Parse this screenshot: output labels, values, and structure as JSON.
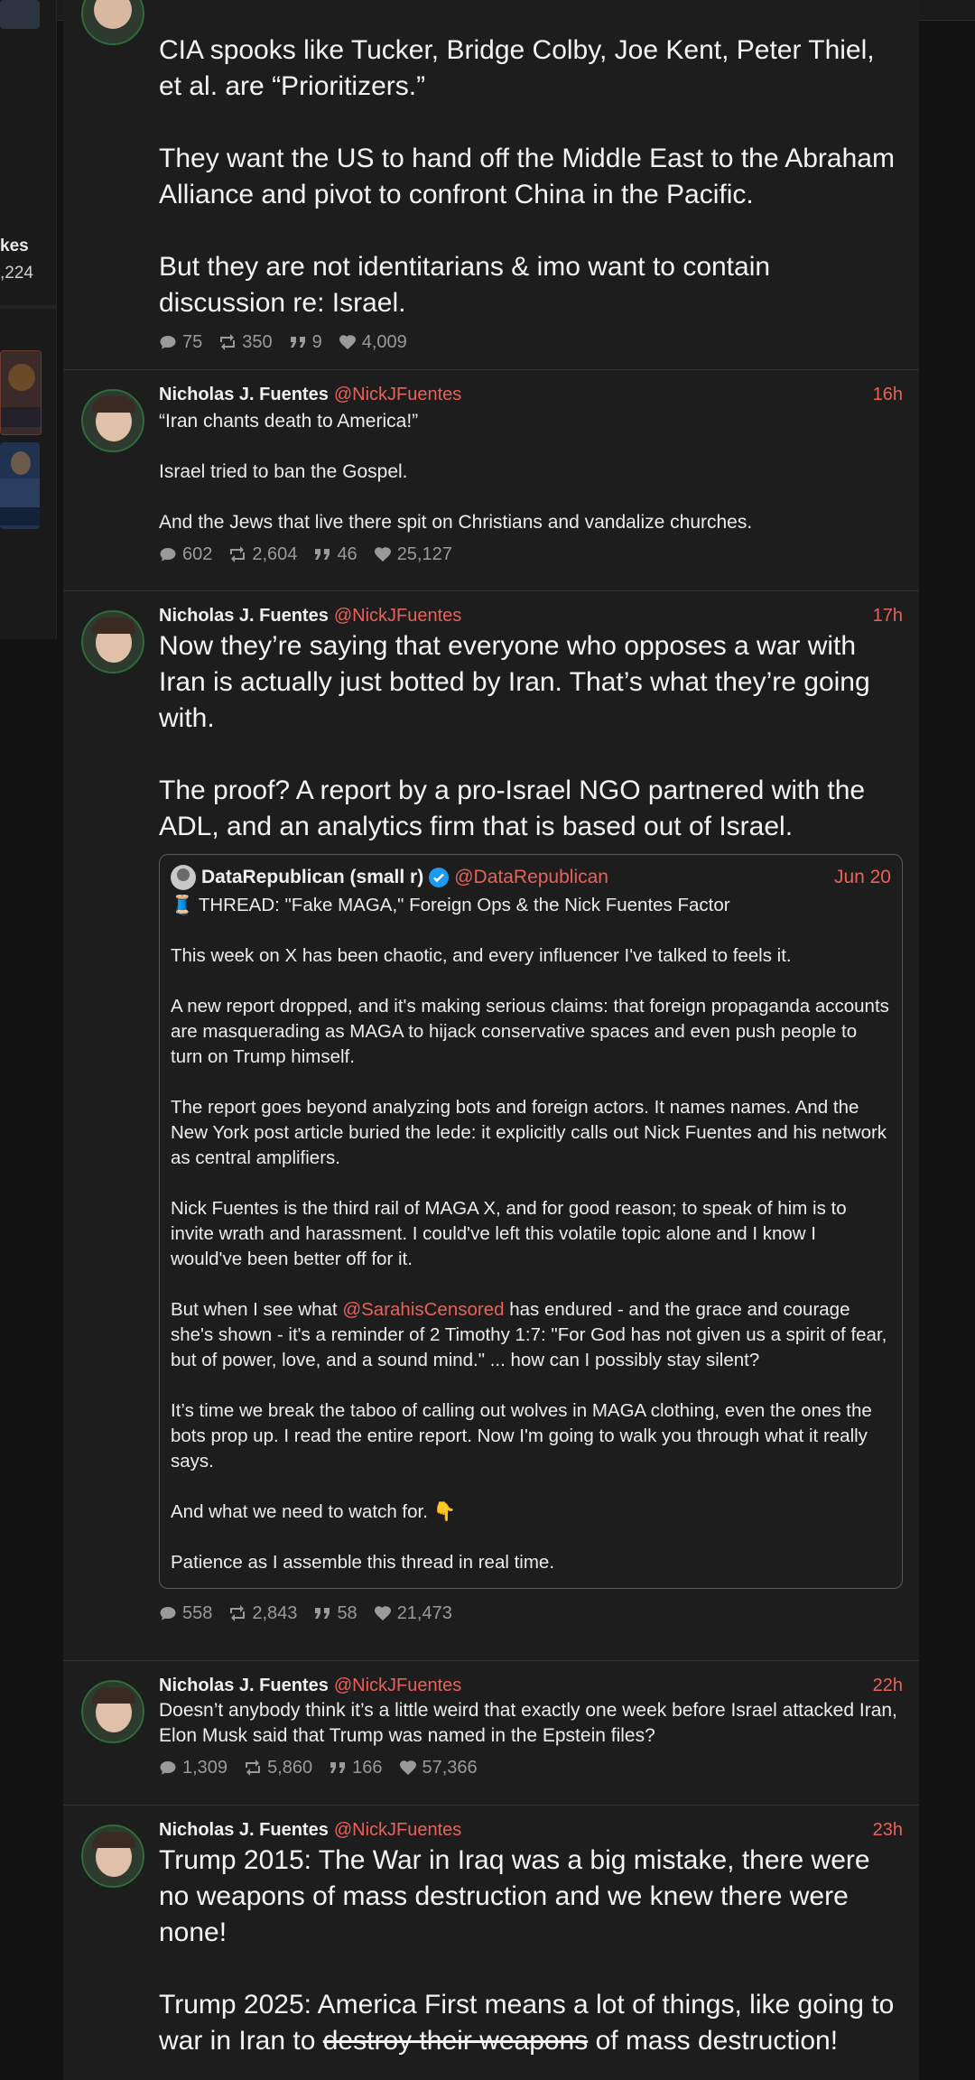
{
  "left_panel": {
    "label_fragment": "kes",
    "value_fragment": ",224"
  },
  "tweets": [
    {
      "p1": "CIA spooks like Tucker, Bridge Colby, Joe Kent, Peter Thiel, et al. are “Prioritizers.”",
      "p2": "They want the US to hand off the Middle East to the Abraham Alliance and pivot to confront China in the Pacific.",
      "p3": "But they are not identitarians & imo want to contain discussion re: Israel.",
      "replies": "75",
      "retweets": "350",
      "quotes": "9",
      "likes": "4,009"
    },
    {
      "name": "Nicholas J. Fuentes",
      "handle": "@NickJFuentes",
      "time": "16h",
      "p1": "“Iran chants death to America!”",
      "p2": "Israel tried to ban the Gospel.",
      "p3": "And the Jews that live there spit on Christians and vandalize churches.",
      "replies": "602",
      "retweets": "2,604",
      "quotes": "46",
      "likes": "25,127"
    },
    {
      "name": "Nicholas J. Fuentes",
      "handle": "@NickJFuentes",
      "time": "17h",
      "p1": "Now they’re saying that everyone who opposes a war with Iran is actually just botted by Iran. That’s what they’re going with.",
      "p2": "The proof? A report by a pro-Israel NGO partnered with the ADL, and an analytics firm that is based out of Israel.",
      "quote": {
        "name": "DataRepublican (small r)",
        "handle": "@DataRepublican",
        "time": "Jun 20",
        "q1": "🧵 THREAD: \"Fake MAGA,\" Foreign Ops & the Nick Fuentes Factor",
        "q2": "This week on X has been chaotic, and every influencer I've talked to feels it.",
        "q3": "A new report dropped, and it's making serious claims: that foreign propaganda accounts are masquerading as MAGA to hijack conservative spaces and even push people to turn on Trump himself.",
        "q4": "The report goes beyond analyzing bots and foreign actors. It names names. And the New York post article buried the lede: it explicitly calls out Nick Fuentes and his network as central amplifiers.",
        "q5": "Nick Fuentes is the third rail of MAGA X, and for good reason; to speak of him is to invite wrath and harassment. I could've left this volatile topic alone and I know I would've been better off for it.",
        "q6_pre": "But when I see what ",
        "q6_mention": "@SarahisCensored",
        "q6_post": " has endured - and the grace and courage she's shown - it's a reminder of 2 Timothy 1:7: \"For God has not given us a spirit of fear, but of power, love, and a sound mind.\" ... how can I possibly stay silent?",
        "q7": "It’s time we break the taboo of calling out wolves in MAGA clothing, even the ones the bots prop up. I read the entire report. Now I'm going to walk you through what it really says.",
        "q8": "And what we need to watch for. 👇",
        "q9": " Patience as I assemble this thread in real time."
      },
      "replies": "558",
      "retweets": "2,843",
      "quotes": "58",
      "likes": "21,473"
    },
    {
      "name": "Nicholas J. Fuentes",
      "handle": "@NickJFuentes",
      "time": "22h",
      "p1": "Doesn’t anybody think it’s a little weird that exactly one week before Israel attacked Iran, Elon Musk said that Trump was named in the Epstein files?",
      "replies": "1,309",
      "retweets": "5,860",
      "quotes": "166",
      "likes": "57,366"
    },
    {
      "name": "Nicholas J. Fuentes",
      "handle": "@NickJFuentes",
      "time": "23h",
      "p1": "Trump 2015: The War in Iraq was a big mistake, there were no weapons of mass destruction and we knew there were none!",
      "p2_pre": "Trump 2025: America First means a lot of things, like going to war in Iran to ",
      "p2_strike": "destroy their weapons",
      "p2_post": " of mass destruction!"
    }
  ]
}
